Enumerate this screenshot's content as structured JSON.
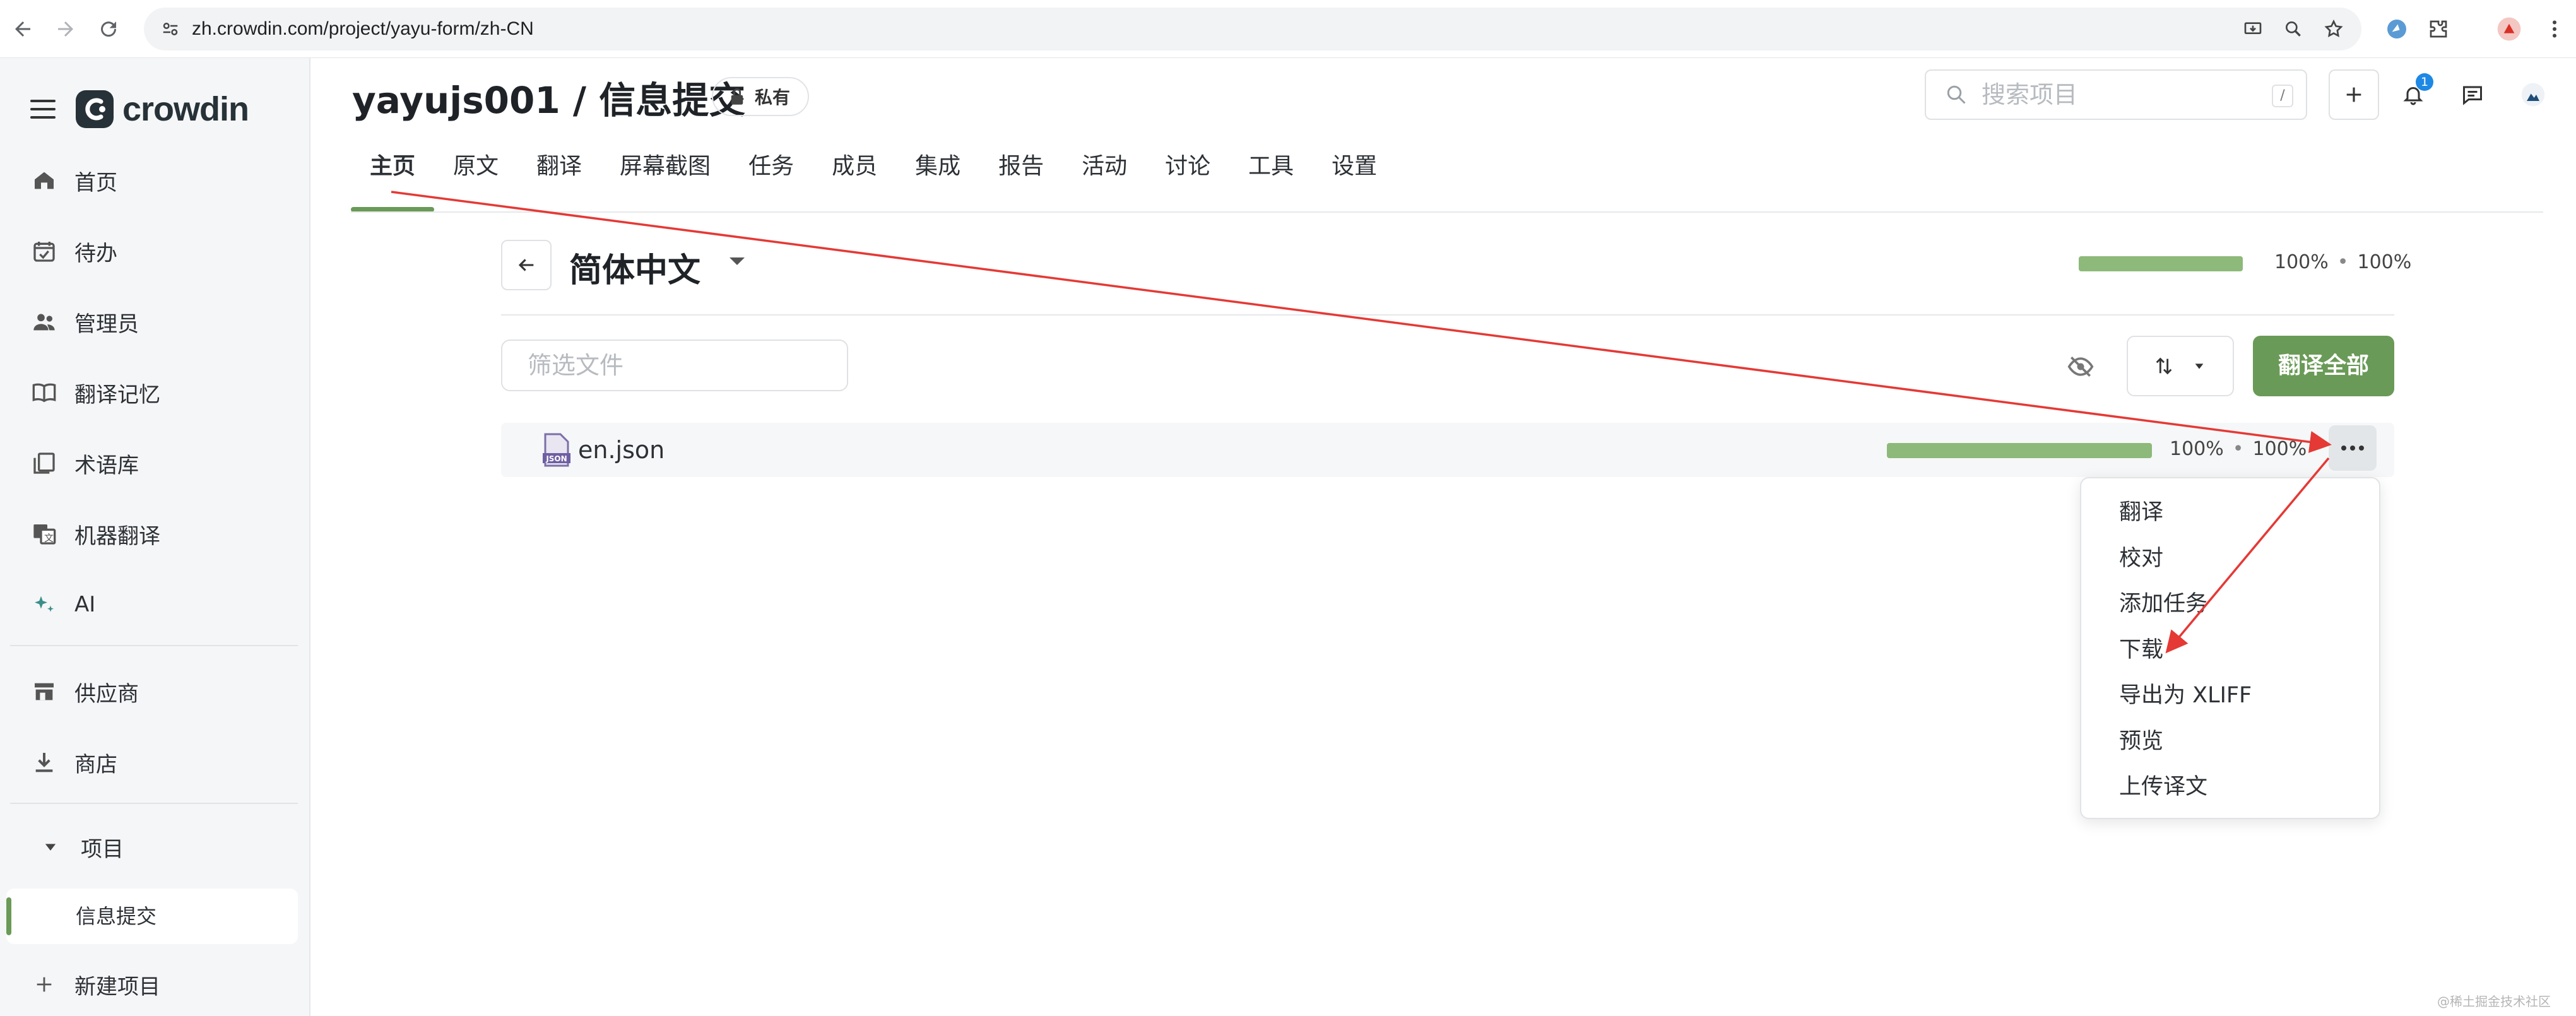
{
  "browser": {
    "url": "zh.crowdin.com/project/yayu-form/zh-CN"
  },
  "sidebar": {
    "brand": "crowdin",
    "items": [
      {
        "label": "首页",
        "icon": "home-icon"
      },
      {
        "label": "待办",
        "icon": "calendar-check-icon"
      },
      {
        "label": "管理员",
        "icon": "people-icon"
      },
      {
        "label": "翻译记忆",
        "icon": "book-icon"
      },
      {
        "label": "术语库",
        "icon": "glossary-icon"
      },
      {
        "label": "机器翻译",
        "icon": "translate-icon"
      },
      {
        "label": "AI",
        "icon": "sparkle-icon"
      },
      {
        "label": "供应商",
        "icon": "store-icon"
      },
      {
        "label": "商店",
        "icon": "download-icon"
      }
    ],
    "projects_label": "项目",
    "active_project": "信息提交",
    "new_project": "新建项目"
  },
  "header": {
    "title": "yayujs001 / 信息提交",
    "private_label": "私有",
    "search_placeholder": "搜索项目",
    "search_shortcut": "/",
    "notification_count": "1"
  },
  "tabs": [
    "主页",
    "原文",
    "翻译",
    "屏幕截图",
    "任务",
    "成员",
    "集成",
    "报告",
    "活动",
    "讨论",
    "工具",
    "设置"
  ],
  "active_tab": "主页",
  "language": {
    "name": "简体中文",
    "translated": "100%",
    "approved": "100%",
    "translated_fraction": 1.0
  },
  "toolbar": {
    "filter_placeholder": "筛选文件",
    "translate_all": "翻译全部"
  },
  "files": [
    {
      "name": "en.json",
      "translated": "100%",
      "approved": "100%",
      "translated_fraction": 1.0
    }
  ],
  "context_menu": [
    "翻译",
    "校对",
    "添加任务",
    "下载",
    "导出为 XLIFF",
    "预览",
    "上传译文"
  ],
  "colors": {
    "accent": "#6a9a57",
    "progress": "#8db97a",
    "annotation": "#e53935"
  },
  "watermark": "@稀土掘金技术社区"
}
